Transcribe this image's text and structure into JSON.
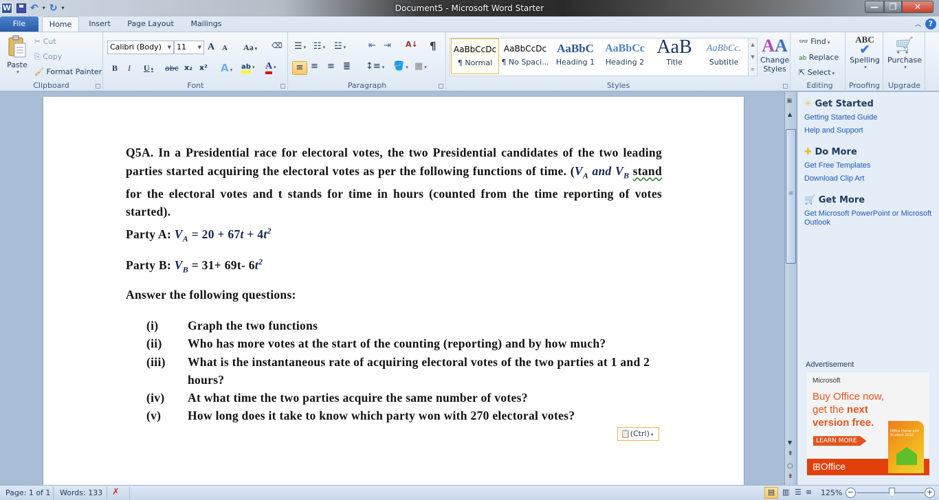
{
  "window": {
    "title": "Document5  -  Microsoft Word Starter",
    "app_icon": "W",
    "minimize": "—",
    "maximize": "❐",
    "close": "✕"
  },
  "qat": {
    "undo_icon": "↶",
    "redo_icon": "↻",
    "customize_icon": "▾"
  },
  "tabs": [
    {
      "label": "File"
    },
    {
      "label": "Home"
    },
    {
      "label": "Insert"
    },
    {
      "label": "Page Layout"
    },
    {
      "label": "Mailings"
    }
  ],
  "ribbon": {
    "clipboard": {
      "label": "Clipboard",
      "paste": "Paste",
      "cut": "Cut",
      "copy": "Copy",
      "format_painter": "Format Painter"
    },
    "font": {
      "label": "Font",
      "font_name": "Calibri (Body)",
      "font_size": "11",
      "grow": "A",
      "shrink": "A",
      "change_case": "Aa",
      "bold": "B",
      "italic": "I",
      "underline": "U",
      "strikethrough": "abc",
      "subscript": "x₂",
      "superscript": "x²",
      "text_effects": "A",
      "highlight": "ab",
      "font_color": "A",
      "highlight_color": "#ffff00",
      "font_color_value": "#e00000"
    },
    "paragraph": {
      "label": "Paragraph",
      "show_marks": "¶",
      "sort": "A↓"
    },
    "styles": {
      "label": "Styles",
      "items": [
        {
          "preview": "AaBbCcDc",
          "name": "¶ Normal",
          "selected": true
        },
        {
          "preview": "AaBbCcDc",
          "name": "¶ No Spaci..."
        },
        {
          "preview": "AaBbC",
          "name": "Heading 1"
        },
        {
          "preview": "AaBbCc",
          "name": "Heading 2"
        },
        {
          "preview": "AaB",
          "name": "Title"
        },
        {
          "preview": "AaBbCc.",
          "name": "Subtitle"
        }
      ],
      "change_styles": "Change Styles"
    },
    "editing": {
      "label": "Editing",
      "find": "Find",
      "replace": "Replace",
      "select": "Select"
    },
    "proofing": {
      "label": "Proofing",
      "spelling": "Spelling"
    },
    "upgrade": {
      "label": "Upgrade",
      "purchase": "Purchase"
    }
  },
  "document": {
    "para1": {
      "lead": "Q5A. In a Presidential race for electoral votes, the two Presidential candidates of the two leading parties started acquiring the electoral votes as per the following functions of time. (",
      "va": "V",
      "va_sub": "A",
      "and": " and ",
      "vb": "V",
      "vb_sub": "B",
      "stand": "stand",
      "tail": " for the electoral votes and t stands for time in hours (counted from the time reporting of votes started)."
    },
    "party_a": {
      "label": "Party A: ",
      "v": "V",
      "sub": "A",
      "eq": " = 20 + 67",
      "t1": "t",
      "plus": " + 4",
      "t2": "t",
      "exp": "2"
    },
    "party_b": {
      "label": "Party B:  ",
      "v": "V",
      "sub": "B",
      "eq": " = 31+ 69t- 6",
      "t2": "t",
      "exp": "2"
    },
    "answer_heading": "Answer the following questions:",
    "questions": [
      {
        "num": "(i)",
        "text": "Graph the two functions"
      },
      {
        "num": "(ii)",
        "text": "Who has more votes at the start of the counting (reporting) and by how much?"
      },
      {
        "num": "(iii)",
        "text": "What is the instantaneous rate of acquiring electoral votes of the two parties at 1 and 2 hours?"
      },
      {
        "num": "(iv)",
        "text": "At what time the two parties acquire the same number  of votes?"
      },
      {
        "num": "(v)",
        "text": "How long does it take to know which party won with 270 electoral votes?"
      }
    ],
    "paste_options": "(Ctrl)"
  },
  "task_pane": {
    "sections": [
      {
        "title": "Get Started",
        "links": [
          "Getting Started Guide",
          "Help and Support"
        ]
      },
      {
        "title": "Do More",
        "links": [
          "Get Free Templates",
          "Download Clip Art"
        ]
      },
      {
        "title": "Get More",
        "links": [
          "Get Microsoft PowerPoint or Microsoft Outlook"
        ]
      }
    ],
    "ad_label": "Advertisement",
    "ad": {
      "brand": "Microsoft",
      "line1": "Buy Office now,",
      "line2_pre": "get the ",
      "line2_bold": "next",
      "line3": "version free.",
      "cta": "LEARN MORE",
      "logo": "Office",
      "box_text": "Office Home and Student 2010"
    }
  },
  "status": {
    "page": "Page: 1 of 1",
    "words": "Words: 133",
    "zoom": "125%",
    "zoom_minus": "−",
    "zoom_plus": "+",
    "zoom_level_percent": 125
  }
}
